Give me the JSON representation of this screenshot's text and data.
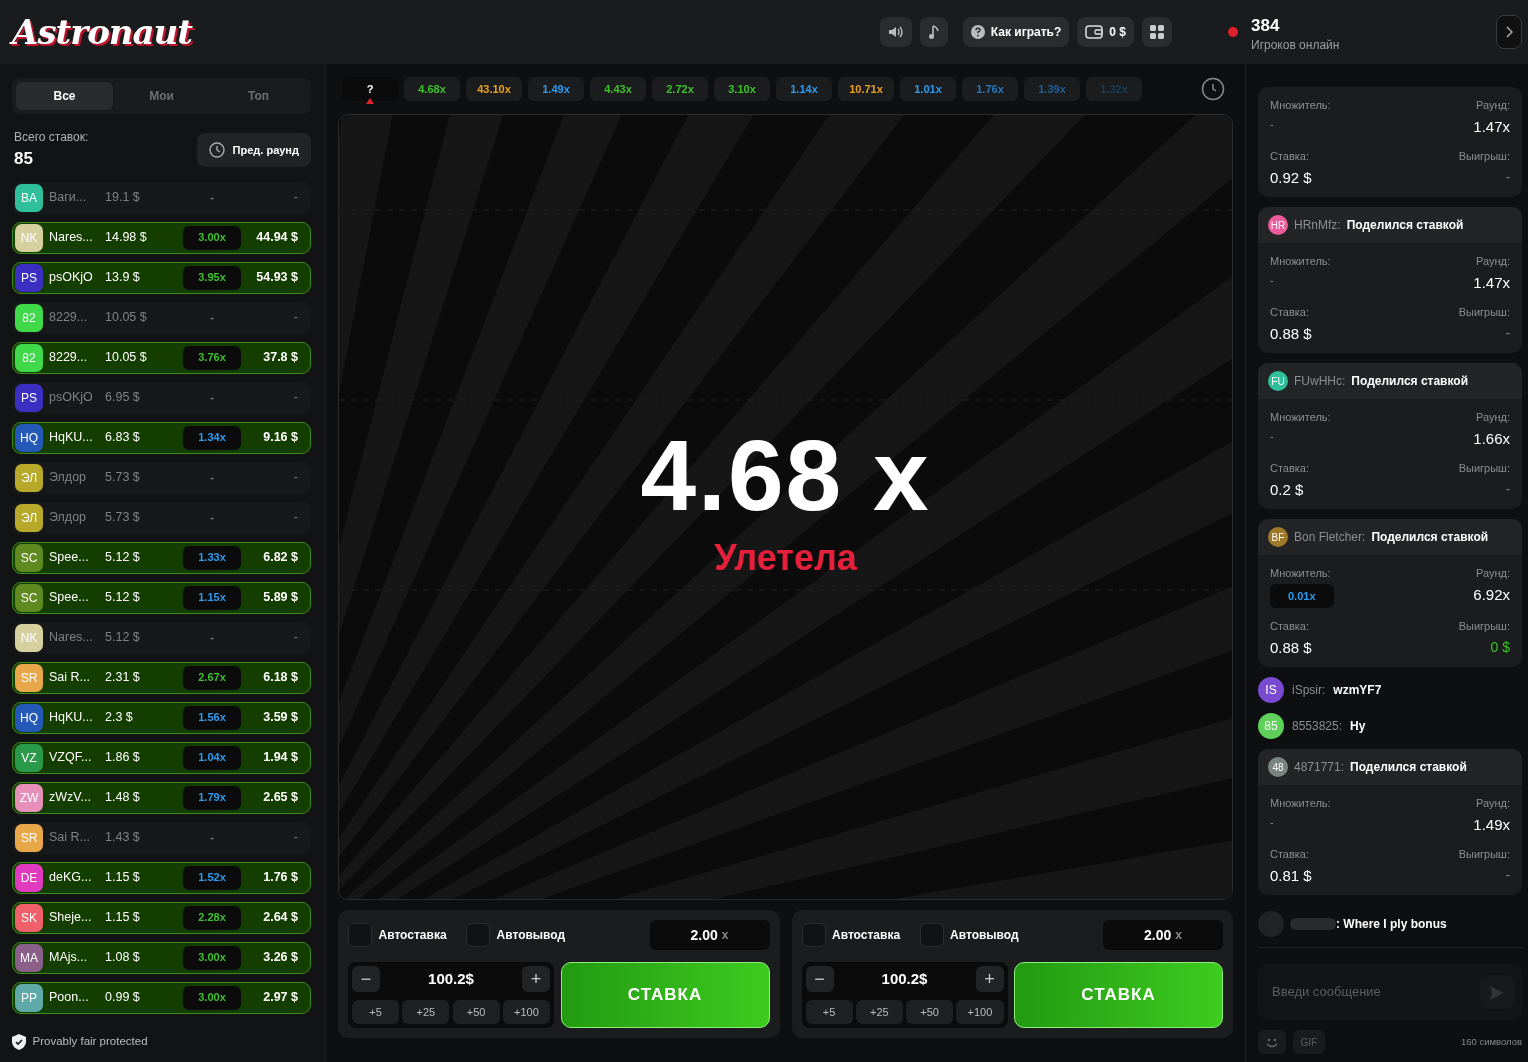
{
  "header": {
    "logo": "Astronaut",
    "help": "Как играть?",
    "balance": "0 $",
    "online_count": "384",
    "online_label": "Игроков онлайн"
  },
  "bets_panel": {
    "tabs": [
      {
        "label": "Все",
        "selected": true
      },
      {
        "label": "Мои",
        "selected": false
      },
      {
        "label": "Топ",
        "selected": false
      }
    ],
    "total_label": "Всего ставок:",
    "total": "85",
    "prev_round": "Пред. раунд",
    "rows": [
      {
        "avatar": {
          "initials": "BA",
          "color": "#2fbf9a"
        },
        "name": "Ваги...",
        "amount": "19.1 $",
        "won": false,
        "multiplier": "-",
        "win": "-"
      },
      {
        "avatar": {
          "initials": "NK",
          "color": "#d6cf9e"
        },
        "name": "Nares...",
        "amount": "14.98 $",
        "won": true,
        "multiplier": "3.00x",
        "color": "#3dc12b",
        "win": "44.94 $"
      },
      {
        "avatar": {
          "initials": "PS",
          "color": "#3a2fc0"
        },
        "name": "psOKjO",
        "amount": "13.9 $",
        "won": true,
        "multiplier": "3.95x",
        "color": "#3dc12b",
        "win": "54.93 $"
      },
      {
        "avatar": {
          "initials": "82",
          "color": "#3fd94a"
        },
        "name": "8229...",
        "amount": "10.05 $",
        "won": false,
        "multiplier": "-",
        "win": "-"
      },
      {
        "avatar": {
          "initials": "82",
          "color": "#3fd94a"
        },
        "name": "8229...",
        "amount": "10.05 $",
        "won": true,
        "multiplier": "3.76x",
        "color": "#3dc12b",
        "win": "37.8 $"
      },
      {
        "avatar": {
          "initials": "PS",
          "color": "#3a2fc0"
        },
        "name": "psOKjO",
        "amount": "6.95 $",
        "won": false,
        "multiplier": "-",
        "win": "-"
      },
      {
        "avatar": {
          "initials": "HQ",
          "color": "#2459b8"
        },
        "name": "HqKU...",
        "amount": "6.83 $",
        "won": true,
        "multiplier": "1.34x",
        "color": "#2d9bf0",
        "win": "9.16 $"
      },
      {
        "avatar": {
          "initials": "ЭЛ",
          "color": "#b8a92a"
        },
        "name": "Элдор",
        "amount": "5.73 $",
        "won": false,
        "multiplier": "-",
        "win": "-"
      },
      {
        "avatar": {
          "initials": "ЭЛ",
          "color": "#b8a92a"
        },
        "name": "Элдор",
        "amount": "5.73 $",
        "won": false,
        "multiplier": "-",
        "win": "-"
      },
      {
        "avatar": {
          "initials": "SC",
          "color": "#5f8a1f"
        },
        "name": "Spee...",
        "amount": "5.12 $",
        "won": true,
        "multiplier": "1.33x",
        "color": "#2d9bf0",
        "win": "6.82 $"
      },
      {
        "avatar": {
          "initials": "SC",
          "color": "#5f8a1f"
        },
        "name": "Spee...",
        "amount": "5.12 $",
        "won": true,
        "multiplier": "1.15x",
        "color": "#2d9bf0",
        "win": "5.89 $"
      },
      {
        "avatar": {
          "initials": "NK",
          "color": "#d6cf9e"
        },
        "name": "Nares...",
        "amount": "5.12 $",
        "won": false,
        "multiplier": "-",
        "win": "-"
      },
      {
        "avatar": {
          "initials": "SR",
          "color": "#e8a84a"
        },
        "name": "Sai R...",
        "amount": "2.31 $",
        "won": true,
        "multiplier": "2.67x",
        "color": "#3dc12b",
        "win": "6.18 $"
      },
      {
        "avatar": {
          "initials": "HQ",
          "color": "#2459b8"
        },
        "name": "HqKU...",
        "amount": "2.3 $",
        "won": true,
        "multiplier": "1.56x",
        "color": "#2d9bf0",
        "win": "3.59 $"
      },
      {
        "avatar": {
          "initials": "VZ",
          "color": "#2a9a4a"
        },
        "name": "VZQF...",
        "amount": "1.86 $",
        "won": true,
        "multiplier": "1.04x",
        "color": "#2d9bf0",
        "win": "1.94 $"
      },
      {
        "avatar": {
          "initials": "ZW",
          "color": "#e68fb8"
        },
        "name": "zWzV...",
        "amount": "1.48 $",
        "won": true,
        "multiplier": "1.79x",
        "color": "#2d9bf0",
        "win": "2.65 $"
      },
      {
        "avatar": {
          "initials": "SR",
          "color": "#e8a84a"
        },
        "name": "Sai R...",
        "amount": "1.43 $",
        "won": false,
        "multiplier": "-",
        "win": "-"
      },
      {
        "avatar": {
          "initials": "DE",
          "color": "#e03bbf"
        },
        "name": "deKG...",
        "amount": "1.15 $",
        "won": true,
        "multiplier": "1.52x",
        "color": "#2d9bf0",
        "win": "1.76 $"
      },
      {
        "avatar": {
          "initials": "SK",
          "color": "#f0606a"
        },
        "name": "Sheje...",
        "amount": "1.15 $",
        "won": true,
        "multiplier": "2.28x",
        "color": "#3dc12b",
        "win": "2.64 $"
      },
      {
        "avatar": {
          "initials": "MA",
          "color": "#8a5f8a"
        },
        "name": "MAjs...",
        "amount": "1.08 $",
        "won": true,
        "multiplier": "3.00x",
        "color": "#3dc12b",
        "win": "3.26 $"
      },
      {
        "avatar": {
          "initials": "PP",
          "color": "#5fa9a9"
        },
        "name": "Poon...",
        "amount": "0.99 $",
        "won": true,
        "multiplier": "3.00x",
        "color": "#3dc12b",
        "win": "2.97 $"
      }
    ],
    "footer": "Provably fair protected"
  },
  "history": [
    {
      "value": "?",
      "current": true,
      "color": "#ffffff"
    },
    {
      "value": "4.68x",
      "current": false,
      "color": "#3dc12b"
    },
    {
      "value": "43.10x",
      "current": false,
      "color": "#e8a020"
    },
    {
      "value": "1.49x",
      "current": false,
      "color": "#2d9bf0"
    },
    {
      "value": "4.43x",
      "current": false,
      "color": "#3dc12b"
    },
    {
      "value": "2.72x",
      "current": false,
      "color": "#3dc12b"
    },
    {
      "value": "3.10x",
      "current": false,
      "color": "#3dc12b"
    },
    {
      "value": "1.14x",
      "current": false,
      "color": "#2d9bf0"
    },
    {
      "value": "10.71x",
      "current": false,
      "color": "#e8a020"
    },
    {
      "value": "1.01x",
      "current": false,
      "color": "#2d9bf0"
    },
    {
      "value": "1.76x",
      "current": false,
      "color": "#2479c0"
    },
    {
      "value": "1.39x",
      "current": false,
      "color": "#1f5f96"
    },
    {
      "value": "1.32x",
      "current": false,
      "color": "#173f5f"
    }
  ],
  "game": {
    "multiplier": "4.68",
    "multiplier_unit": "x",
    "status": "Улетела"
  },
  "bet_panels": [
    {
      "autobet_label": "Автоставка",
      "autobet": false,
      "autocashout_label": "Автовывод",
      "autocashout": false,
      "cashout": "2.00",
      "cashout_unit": "x",
      "minus": "−",
      "amount": "100.2$",
      "plus": "+",
      "quick": [
        "+5",
        "+25",
        "+50",
        "+100"
      ],
      "button": "СТАВКА"
    },
    {
      "autobet_label": "Автоставка",
      "autobet": false,
      "autocashout_label": "Автовывод",
      "autocashout": false,
      "cashout": "2.00",
      "cashout_unit": "x",
      "minus": "−",
      "amount": "100.2$",
      "plus": "+",
      "quick": [
        "+5",
        "+25",
        "+50",
        "+100"
      ],
      "button": "СТАВКА"
    }
  ],
  "chat": {
    "messages": [
      {
        "kind": "share_cut",
        "multiplier_label": "Множитель:",
        "multiplier": "-",
        "cashed_out": false,
        "round_label": "Раунд:",
        "round": "1.47x",
        "stake_label": "Ставка:",
        "stake": "0.92 $",
        "win_label": "Выигрыш:",
        "win": "-",
        "won": false
      },
      {
        "kind": "share",
        "avatar": {
          "initials": "HR",
          "color": "#ee5a9a"
        },
        "user": "HRnMfz:",
        "text": "Поделился ставкой",
        "multiplier_label": "Множитель:",
        "multiplier": "-",
        "cashed_out": false,
        "round_label": "Раунд:",
        "round": "1.47x",
        "stake_label": "Ставка:",
        "stake": "0.88 $",
        "win_label": "Выигрыш:",
        "win": "-",
        "won": false
      },
      {
        "kind": "share",
        "avatar": {
          "initials": "FU",
          "color": "#2fbf9a"
        },
        "user": "FUwHHc:",
        "text": "Поделился ставкой",
        "multiplier_label": "Множитель:",
        "multiplier": "-",
        "cashed_out": false,
        "round_label": "Раунд:",
        "round": "1.66x",
        "stake_label": "Ставка:",
        "stake": "0.2 $",
        "win_label": "Выигрыш:",
        "win": "-",
        "won": false
      },
      {
        "kind": "share",
        "avatar": {
          "initials": "BF",
          "color": "#a0782a"
        },
        "user": "Bon Fletcher:",
        "text": "Поделился ставкой",
        "multiplier_label": "Множитель:",
        "multiplier": "0.01x",
        "cashed_out": true,
        "round_label": "Раунд:",
        "round": "6.92x",
        "stake_label": "Ставка:",
        "stake": "0.88 $",
        "win_label": "Выигрыш:",
        "win": "0 $",
        "won": true
      },
      {
        "kind": "message",
        "avatar": {
          "initials": "IS",
          "color": "#7a4ad0"
        },
        "user": "iSpsir:",
        "text": "wzmYF7"
      },
      {
        "kind": "message",
        "avatar": {
          "initials": "85",
          "color": "#5fd05a"
        },
        "user": "8553825:",
        "text": "Ну"
      },
      {
        "kind": "share",
        "avatar": {
          "initials": "48",
          "color": "#7a857f"
        },
        "user": "4871771:",
        "text": "Поделился ставкой",
        "multiplier_label": "Множитель:",
        "multiplier": "-",
        "cashed_out": false,
        "round_label": "Раунд:",
        "round": "1.49x",
        "stake_label": "Ставка:",
        "stake": "0.81 $",
        "win_label": "Выигрыш:",
        "win": "-",
        "won": false
      },
      {
        "kind": "hidden",
        "text": ": Where I ply bonus"
      }
    ],
    "placeholder": "Введи сообщение",
    "gif": "GIF",
    "limit": "160 символов"
  }
}
